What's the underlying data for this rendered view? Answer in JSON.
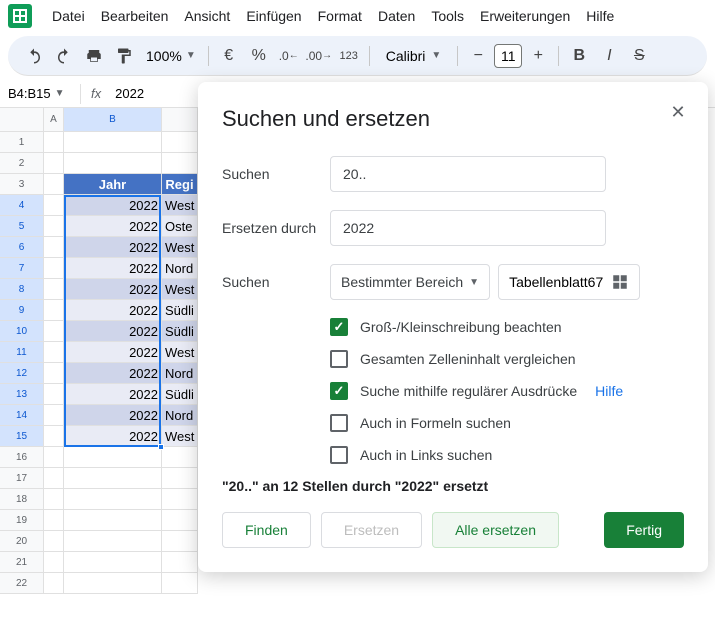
{
  "menu": [
    "Datei",
    "Bearbeiten",
    "Ansicht",
    "Einfügen",
    "Format",
    "Daten",
    "Tools",
    "Erweiterungen",
    "Hilfe"
  ],
  "toolbar": {
    "zoom": "100%",
    "font": "Calibri",
    "size": "11"
  },
  "namebox": "B4:B15",
  "formula": "2022",
  "columns": [
    "A",
    "B"
  ],
  "headerRow": {
    "b": "Jahr",
    "c": "Regi"
  },
  "rows": [
    {
      "n": "1"
    },
    {
      "n": "2"
    },
    {
      "n": "3",
      "head": true
    },
    {
      "n": "4",
      "b": "2022",
      "c": "West"
    },
    {
      "n": "5",
      "b": "2022",
      "c": "Oste"
    },
    {
      "n": "6",
      "b": "2022",
      "c": "West"
    },
    {
      "n": "7",
      "b": "2022",
      "c": "Nord"
    },
    {
      "n": "8",
      "b": "2022",
      "c": "West"
    },
    {
      "n": "9",
      "b": "2022",
      "c": "Südli"
    },
    {
      "n": "10",
      "b": "2022",
      "c": "Südli"
    },
    {
      "n": "11",
      "b": "2022",
      "c": "West"
    },
    {
      "n": "12",
      "b": "2022",
      "c": "Nord"
    },
    {
      "n": "13",
      "b": "2022",
      "c": "Südli"
    },
    {
      "n": "14",
      "b": "2022",
      "c": "Nord"
    },
    {
      "n": "15",
      "b": "2022",
      "c": "West"
    },
    {
      "n": "16"
    },
    {
      "n": "17"
    },
    {
      "n": "18"
    },
    {
      "n": "19"
    },
    {
      "n": "20"
    },
    {
      "n": "21"
    },
    {
      "n": "22"
    }
  ],
  "dialog": {
    "title": "Suchen und ersetzen",
    "searchLabel": "Suchen",
    "searchValue": "20..",
    "replaceLabel": "Ersetzen durch",
    "replaceValue": "2022",
    "searchInLabel": "Suchen",
    "rangeType": "Bestimmter Bereich",
    "rangeValue": "Tabellenblatt67",
    "checks": {
      "case": "Groß-/Kleinschreibung beachten",
      "entire": "Gesamten Zelleninhalt vergleichen",
      "regex": "Suche mithilfe regulärer Ausdrücke",
      "formulas": "Auch in Formeln suchen",
      "links": "Auch in Links suchen"
    },
    "help": "Hilfe",
    "status": "\"20..\" an 12 Stellen durch \"2022\" ersetzt",
    "buttons": {
      "find": "Finden",
      "replace": "Ersetzen",
      "replaceAll": "Alle ersetzen",
      "done": "Fertig"
    }
  }
}
